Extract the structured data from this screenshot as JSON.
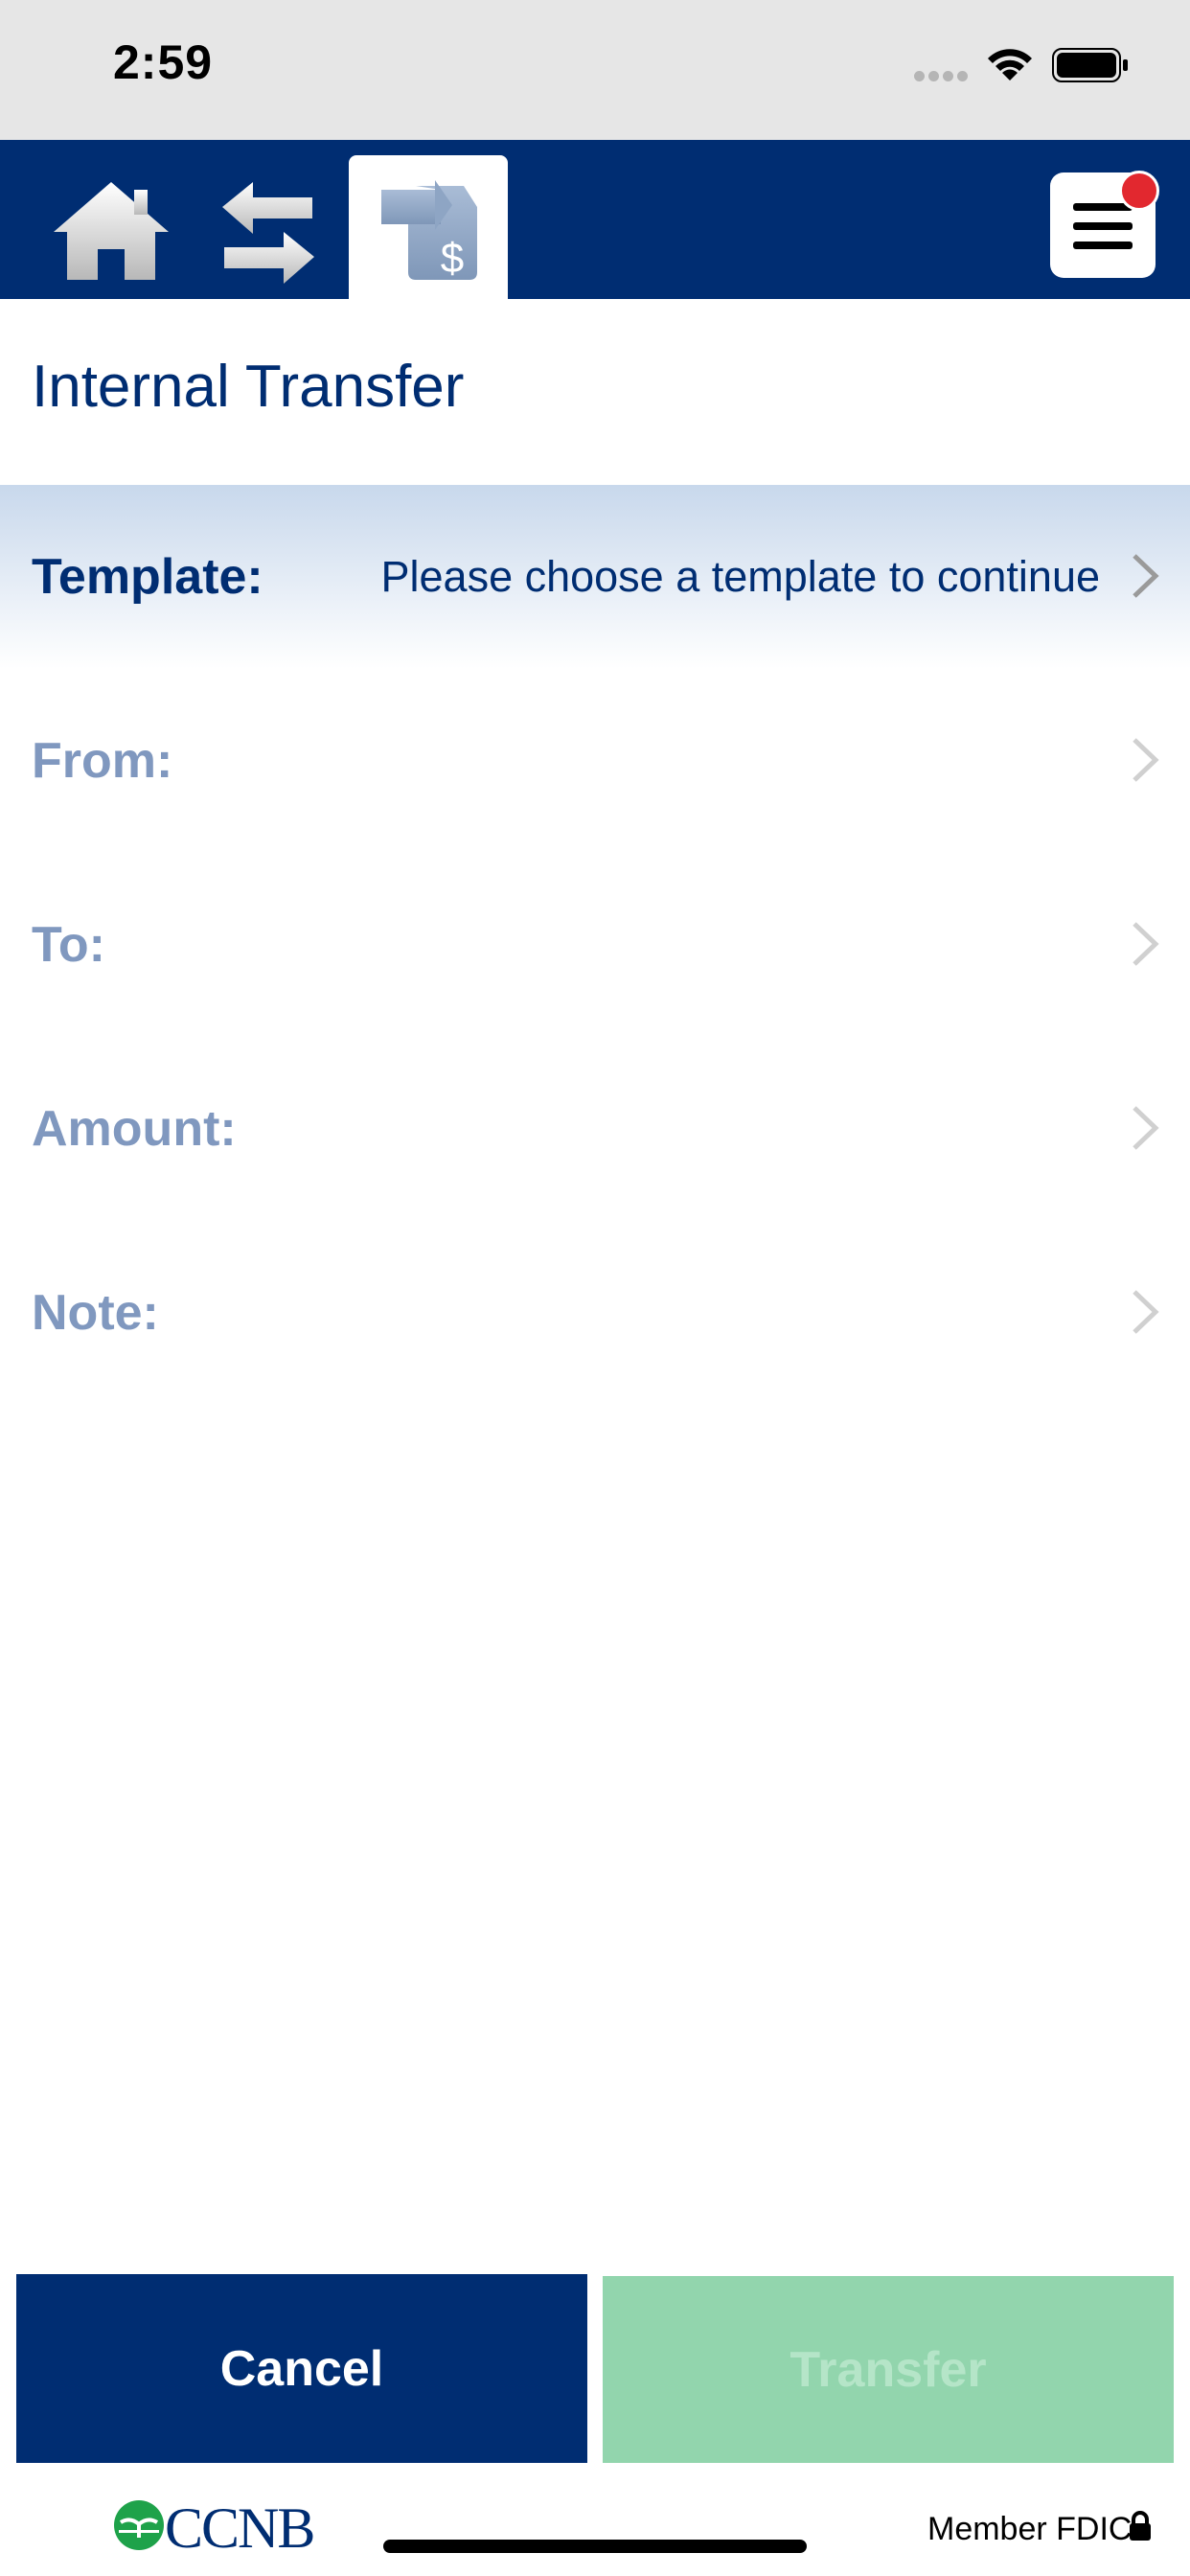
{
  "status_bar": {
    "time": "2:59"
  },
  "nav": {
    "home_icon": "home-icon",
    "transfer_icon": "transfer-arrows-icon",
    "active_tab_icon": "transfer-dollar-icon",
    "menu_icon": "hamburger-menu-icon",
    "has_notification": true
  },
  "page": {
    "title": "Internal Transfer"
  },
  "form": {
    "template": {
      "label": "Template:",
      "value": "Please choose a template to continue"
    },
    "from": {
      "label": "From:"
    },
    "to": {
      "label": "To:"
    },
    "amount": {
      "label": "Amount:"
    },
    "note": {
      "label": "Note:"
    }
  },
  "buttons": {
    "cancel": "Cancel",
    "transfer": "Transfer"
  },
  "footer": {
    "logo_text": "CCNB",
    "fdic": "Member FDIC"
  },
  "colors": {
    "primary": "#002d72",
    "disabled_label": "#8098bf",
    "transfer_button": "#92d5ad",
    "notification": "#e2282f"
  }
}
